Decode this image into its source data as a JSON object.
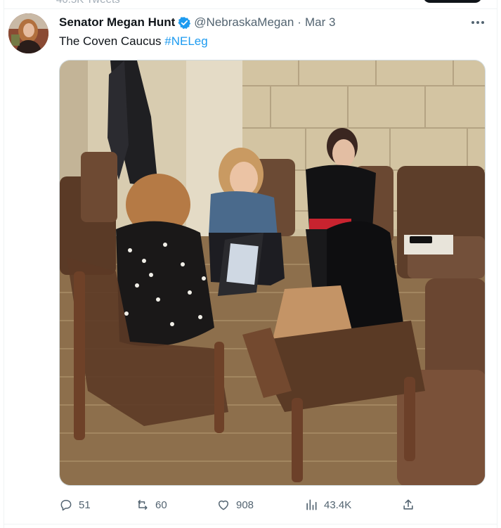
{
  "top_strip": {
    "tweets_count": "40.5K Tweets"
  },
  "tweet": {
    "author_name": "Senator Megan Hunt",
    "handle": "@NebraskaMegan",
    "separator": "·",
    "date": "Mar 3",
    "text": "The Coven Caucus ",
    "hashtag": "#NELeg",
    "verified": true
  },
  "actions": {
    "replies": "51",
    "retweets": "60",
    "likes": "908",
    "views": "43.4K"
  },
  "colors": {
    "accent": "#1d9bf0",
    "text_primary": "#0f1419",
    "text_secondary": "#536471"
  },
  "icons": [
    "verified-badge-icon",
    "more-options-icon",
    "reply-icon",
    "retweet-icon",
    "like-icon",
    "views-icon",
    "share-icon"
  ]
}
